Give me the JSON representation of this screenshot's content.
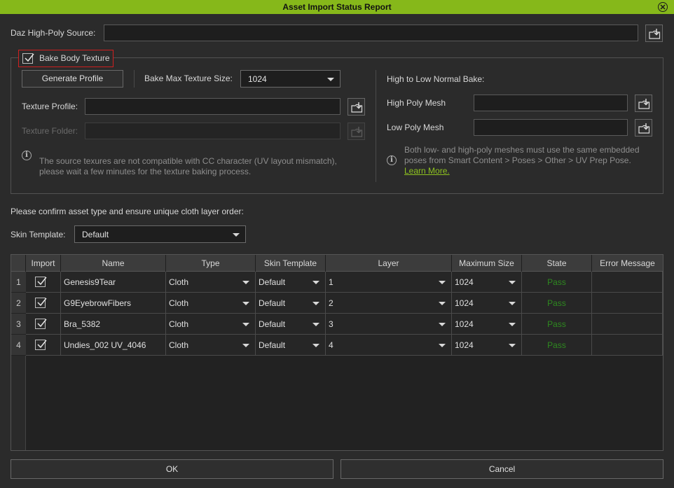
{
  "window": {
    "title": "Asset Import Status Report"
  },
  "source": {
    "label": "Daz High-Poly Source:",
    "value": ""
  },
  "bake": {
    "checkbox_label": "Bake Body Texture",
    "checked": true,
    "generate_profile": "Generate Profile",
    "max_size_label": "Bake Max Texture Size:",
    "max_size_value": "1024",
    "texture_profile_label": "Texture Profile:",
    "texture_folder_label": "Texture Folder:",
    "note_line1": "The source texures are not compatible with CC character (UV layout mismatch),",
    "note_line2": "please wait a few minutes for the texture baking process."
  },
  "normal_bake": {
    "title": "High to Low Normal Bake:",
    "high_label": "High Poly Mesh",
    "low_label": "Low Poly Mesh",
    "note_line1": "Both low- and high-poly meshes must use the same embedded",
    "note_line2": "poses from Smart Content > Poses > Other > UV Prep Pose.",
    "learn_more": "Learn More."
  },
  "confirm_text": "Please confirm asset type and ensure unique cloth layer order:",
  "skin_template": {
    "label": "Skin Template:",
    "value": "Default"
  },
  "table": {
    "headers": {
      "import": "Import",
      "name": "Name",
      "type": "Type",
      "skin": "Skin Template",
      "layer": "Layer",
      "maxsize": "Maximum Size",
      "state": "State",
      "error": "Error Message"
    },
    "rows": [
      {
        "num": "1",
        "name": "Genesis9Tear",
        "type": "Cloth",
        "skin": "Default",
        "layer": "1",
        "maxsize": "1024",
        "state": "Pass",
        "error": ""
      },
      {
        "num": "2",
        "name": "G9EyebrowFibers",
        "type": "Cloth",
        "skin": "Default",
        "layer": "2",
        "maxsize": "1024",
        "state": "Pass",
        "error": ""
      },
      {
        "num": "3",
        "name": "Bra_5382",
        "type": "Cloth",
        "skin": "Default",
        "layer": "3",
        "maxsize": "1024",
        "state": "Pass",
        "error": ""
      },
      {
        "num": "4",
        "name": "Undies_002 UV_4046",
        "type": "Cloth",
        "skin": "Default",
        "layer": "4",
        "maxsize": "1024",
        "state": "Pass",
        "error": ""
      }
    ]
  },
  "buttons": {
    "ok": "OK",
    "cancel": "Cancel"
  },
  "colors": {
    "titlebar": "#86b81a",
    "pass": "#2e8a1f",
    "link": "#8fc41f"
  }
}
